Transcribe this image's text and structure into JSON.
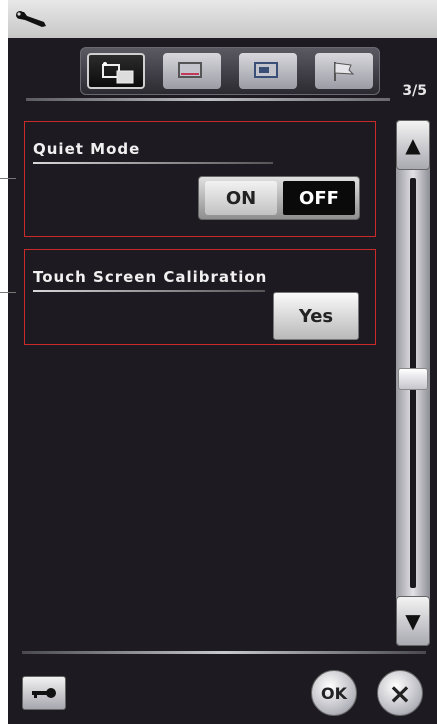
{
  "header": {
    "icon": "wrench-icon"
  },
  "tabs": [
    {
      "icon": "general-settings-icon",
      "active": true
    },
    {
      "icon": "display-settings-icon",
      "active": false
    },
    {
      "icon": "machine-settings-icon",
      "active": false
    },
    {
      "icon": "flag-icon",
      "active": false
    }
  ],
  "page_indicator": "3/5",
  "quiet_mode": {
    "title": "Quiet Mode",
    "on_label": "ON",
    "off_label": "OFF",
    "selected": "OFF"
  },
  "touch_calibration": {
    "title": "Touch Screen Calibration",
    "button_label": "Yes"
  },
  "scrollbar": {
    "up_icon": "up-arrow-icon",
    "down_icon": "down-arrow-icon"
  },
  "footer": {
    "key_icon": "key-icon",
    "ok_label": "OK",
    "close_label": "×"
  },
  "colors": {
    "background": "#1d1b21",
    "highlight_border": "#c92a2a",
    "header": "#d6d6d6"
  }
}
